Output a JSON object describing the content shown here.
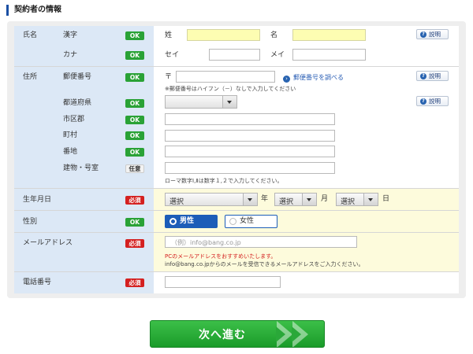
{
  "section_title": "契約者の情報",
  "rows": {
    "name": {
      "label": "氏名",
      "kanji": {
        "label": "漢字",
        "status": "OK",
        "sei_prefix": "姓",
        "mei_prefix": "名",
        "sei_value": "",
        "mei_value": ""
      },
      "kana": {
        "label": "カナ",
        "status": "OK",
        "sei_prefix": "セイ",
        "mei_prefix": "メイ",
        "sei_value": "",
        "mei_value": ""
      },
      "help": "説明"
    },
    "address": {
      "label": "住所",
      "postal": {
        "label": "郵便番号",
        "status": "OK",
        "prefix": "〒",
        "link": "郵便番号を調べる",
        "note": "※郵便番号はハイフン（－）なしで入力してください",
        "help": "説明"
      },
      "prefecture": {
        "label": "都道府県",
        "status": "OK",
        "value": "",
        "help": "説明"
      },
      "city": {
        "label": "市区郡",
        "status": "OK"
      },
      "town": {
        "label": "町村",
        "status": "OK"
      },
      "banchi": {
        "label": "番地",
        "status": "OK"
      },
      "building": {
        "label": "建物・号室",
        "status": "任意"
      },
      "note": "ローマ数字Ⅰ,Ⅱは数字１,２で入力してください。"
    },
    "birthdate": {
      "label": "生年月日",
      "status": "必須",
      "year": {
        "value": "選択",
        "suffix": "年"
      },
      "month": {
        "value": "選択",
        "suffix": "月"
      },
      "day": {
        "value": "選択",
        "suffix": "日"
      }
    },
    "gender": {
      "label": "性別",
      "status": "OK",
      "options": [
        {
          "label": "男性",
          "selected": true
        },
        {
          "label": "女性",
          "selected": false
        }
      ]
    },
    "email": {
      "label": "メールアドレス",
      "status": "必須",
      "placeholder": "（例）info@bang.co.jp",
      "note1": "PCのメールアドレスをおすすめいたします。",
      "note2": "info@bang.co.jpからのメールを受信できるメールアドレスをご入力ください。"
    },
    "phone": {
      "label": "電話番号",
      "status": "必須"
    }
  },
  "next_button": "次へ進む",
  "colors": {
    "label_bg": "#dce8f6",
    "ok": "#2aa236",
    "required": "#d42020",
    "accent": "#1c5db8",
    "next": "#22a832"
  },
  "icons": {
    "help": "question-circle-icon",
    "link": "arrow-circle-icon",
    "next": "double-chevron-right-icon"
  }
}
